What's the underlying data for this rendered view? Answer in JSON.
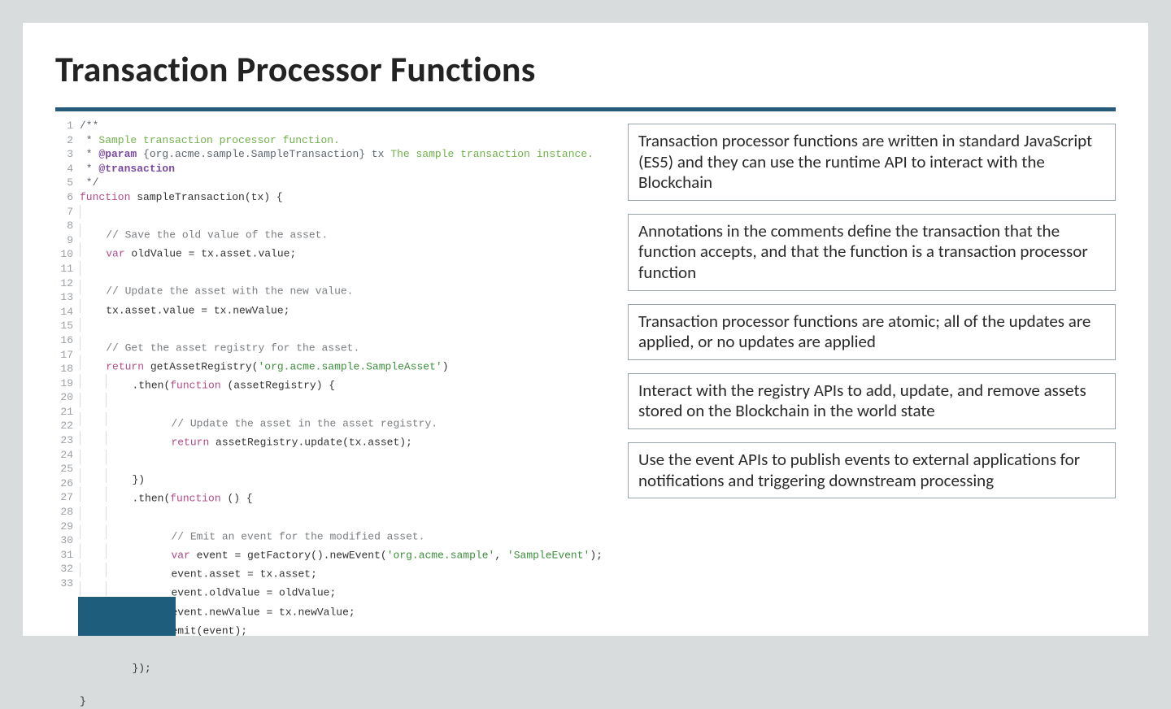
{
  "title": "Transaction Processor Functions",
  "code": {
    "line_count": 33,
    "lines": [
      {
        "n": 1,
        "indent": 0,
        "tokens": [
          {
            "c": "docbl",
            "t": "/**"
          }
        ]
      },
      {
        "n": 2,
        "indent": 0,
        "tokens": [
          {
            "c": "docbl",
            "t": " * "
          },
          {
            "c": "doccmt",
            "t": "Sample transaction processor function."
          }
        ]
      },
      {
        "n": 3,
        "indent": 0,
        "tokens": [
          {
            "c": "docbl",
            "t": " * "
          },
          {
            "c": "tag",
            "t": "@param"
          },
          {
            "c": "docbl",
            "t": " {org.acme.sample.SampleTransaction} tx "
          },
          {
            "c": "doccmt",
            "t": "The sample transaction instance."
          }
        ]
      },
      {
        "n": 4,
        "indent": 0,
        "tokens": [
          {
            "c": "docbl",
            "t": " * "
          },
          {
            "c": "tag",
            "t": "@transaction"
          }
        ]
      },
      {
        "n": 5,
        "indent": 0,
        "tokens": [
          {
            "c": "docbl",
            "t": " */"
          }
        ]
      },
      {
        "n": 6,
        "indent": 0,
        "tokens": [
          {
            "c": "kw",
            "t": "function"
          },
          {
            "c": "ident",
            "t": " sampleTransaction(tx) {"
          }
        ]
      },
      {
        "n": 7,
        "indent": 1,
        "tokens": []
      },
      {
        "n": 8,
        "indent": 1,
        "tokens": [
          {
            "c": "cmt",
            "t": "// Save the old value of the asset."
          }
        ]
      },
      {
        "n": 9,
        "indent": 1,
        "tokens": [
          {
            "c": "kw",
            "t": "var"
          },
          {
            "c": "ident",
            "t": " oldValue = tx.asset.value;"
          }
        ]
      },
      {
        "n": 10,
        "indent": 1,
        "tokens": []
      },
      {
        "n": 11,
        "indent": 1,
        "tokens": [
          {
            "c": "cmt",
            "t": "// Update the asset with the new value."
          }
        ]
      },
      {
        "n": 12,
        "indent": 1,
        "tokens": [
          {
            "c": "ident",
            "t": "tx.asset.value = tx.newValue;"
          }
        ]
      },
      {
        "n": 13,
        "indent": 1,
        "tokens": []
      },
      {
        "n": 14,
        "indent": 1,
        "tokens": [
          {
            "c": "cmt",
            "t": "// Get the asset registry for the asset."
          }
        ]
      },
      {
        "n": 15,
        "indent": 1,
        "tokens": [
          {
            "c": "kw",
            "t": "return"
          },
          {
            "c": "ident",
            "t": " getAssetRegistry("
          },
          {
            "c": "str",
            "t": "'org.acme.sample.SampleAsset'"
          },
          {
            "c": "ident",
            "t": ")"
          }
        ]
      },
      {
        "n": 16,
        "indent": 2,
        "tokens": [
          {
            "c": "ident",
            "t": ".then("
          },
          {
            "c": "kw",
            "t": "function"
          },
          {
            "c": "ident",
            "t": " (assetRegistry) {"
          }
        ]
      },
      {
        "n": 17,
        "indent": 2,
        "tokens": []
      },
      {
        "n": 18,
        "indent": 2,
        "tokens": [
          {
            "c": "sp2",
            "t": ""
          },
          {
            "c": "cmt",
            "t": "// Update the asset in the asset registry."
          }
        ]
      },
      {
        "n": 19,
        "indent": 2,
        "tokens": [
          {
            "c": "sp2",
            "t": ""
          },
          {
            "c": "kw",
            "t": "return"
          },
          {
            "c": "ident",
            "t": " assetRegistry.update(tx.asset);"
          }
        ]
      },
      {
        "n": 20,
        "indent": 2,
        "tokens": []
      },
      {
        "n": 21,
        "indent": 2,
        "tokens": [
          {
            "c": "ident",
            "t": "})"
          }
        ]
      },
      {
        "n": 22,
        "indent": 2,
        "tokens": [
          {
            "c": "ident",
            "t": ".then("
          },
          {
            "c": "kw",
            "t": "function"
          },
          {
            "c": "ident",
            "t": " () {"
          }
        ]
      },
      {
        "n": 23,
        "indent": 2,
        "tokens": []
      },
      {
        "n": 24,
        "indent": 2,
        "tokens": [
          {
            "c": "sp2",
            "t": ""
          },
          {
            "c": "cmt",
            "t": "// Emit an event for the modified asset."
          }
        ]
      },
      {
        "n": 25,
        "indent": 2,
        "tokens": [
          {
            "c": "sp2",
            "t": ""
          },
          {
            "c": "kw",
            "t": "var"
          },
          {
            "c": "ident",
            "t": " event = getFactory().newEvent("
          },
          {
            "c": "str",
            "t": "'org.acme.sample'"
          },
          {
            "c": "ident",
            "t": ", "
          },
          {
            "c": "str",
            "t": "'SampleEvent'"
          },
          {
            "c": "ident",
            "t": ");"
          }
        ]
      },
      {
        "n": 26,
        "indent": 2,
        "tokens": [
          {
            "c": "sp2",
            "t": ""
          },
          {
            "c": "ident",
            "t": "event.asset = tx.asset;"
          }
        ]
      },
      {
        "n": 27,
        "indent": 2,
        "tokens": [
          {
            "c": "sp2",
            "t": ""
          },
          {
            "c": "ident",
            "t": "event.oldValue = oldValue;"
          }
        ]
      },
      {
        "n": 28,
        "indent": 2,
        "tokens": [
          {
            "c": "sp2",
            "t": ""
          },
          {
            "c": "ident",
            "t": "event.newValue = tx.newValue;"
          }
        ]
      },
      {
        "n": 29,
        "indent": 2,
        "tokens": [
          {
            "c": "sp2",
            "t": ""
          },
          {
            "c": "ident",
            "t": "emit(event);"
          }
        ]
      },
      {
        "n": 30,
        "indent": 2,
        "tokens": []
      },
      {
        "n": 31,
        "indent": 2,
        "tokens": [
          {
            "c": "ident",
            "t": "});"
          }
        ]
      },
      {
        "n": 32,
        "indent": 1,
        "tokens": []
      },
      {
        "n": 33,
        "indent": 0,
        "tokens": [
          {
            "c": "ident",
            "t": "}"
          }
        ]
      }
    ]
  },
  "boxes": [
    "Transaction processor functions are written in standard JavaScript (ES5) and they can use the runtime API to interact with the Blockchain",
    "Annotations in the comments define the transaction that the function accepts, and that the function is a transaction processor function",
    "Transaction processor functions are atomic; all of the updates are applied, or no updates are applied",
    "Interact with the registry APIs to add, update, and remove assets stored on the Blockchain in the world state",
    "Use the event APIs to publish events to external applications for notifications and triggering downstream processing"
  ]
}
